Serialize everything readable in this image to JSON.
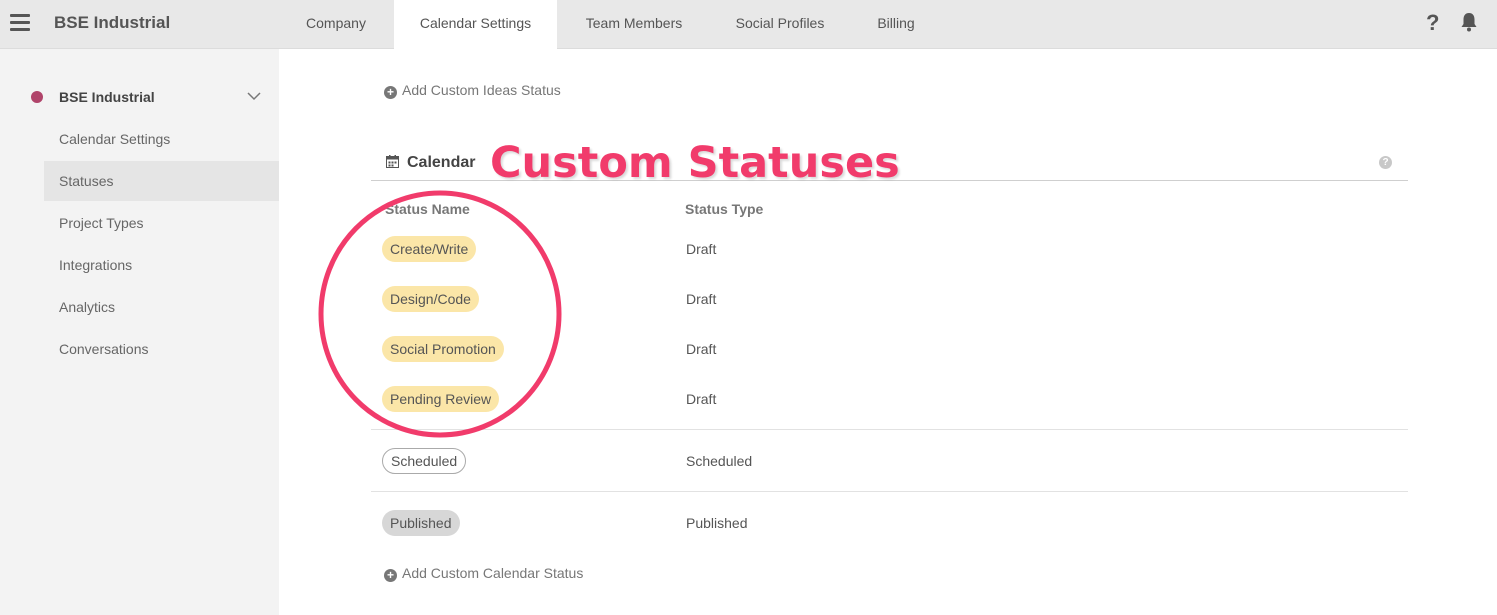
{
  "header": {
    "app_title": "BSE Industrial",
    "tabs": [
      {
        "label": "Company"
      },
      {
        "label": "Calendar Settings"
      },
      {
        "label": "Team Members"
      },
      {
        "label": "Social Profiles"
      },
      {
        "label": "Billing"
      }
    ],
    "help_icon": "?"
  },
  "sidebar": {
    "org_name": "BSE Industrial",
    "org_color": "#b0446a",
    "items": [
      {
        "label": "Calendar Settings"
      },
      {
        "label": "Statuses"
      },
      {
        "label": "Project Types"
      },
      {
        "label": "Integrations"
      },
      {
        "label": "Analytics"
      },
      {
        "label": "Conversations"
      }
    ]
  },
  "main": {
    "add_ideas_status": "Add Custom Ideas Status",
    "section_title": "Calendar",
    "annotation_text": "Custom Statuses",
    "annotation_color": "#f13b6b",
    "columns": {
      "name": "Status Name",
      "type": "Status Type"
    },
    "statuses": [
      {
        "name": "Create/Write",
        "type": "Draft"
      },
      {
        "name": "Design/Code",
        "type": "Draft"
      },
      {
        "name": "Social Promotion",
        "type": "Draft"
      },
      {
        "name": "Pending Review",
        "type": "Draft"
      },
      {
        "name": "Scheduled",
        "type": "Scheduled"
      },
      {
        "name": "Published",
        "type": "Published"
      }
    ],
    "add_calendar_status": "Add Custom Calendar Status",
    "help_glyph": "?"
  }
}
